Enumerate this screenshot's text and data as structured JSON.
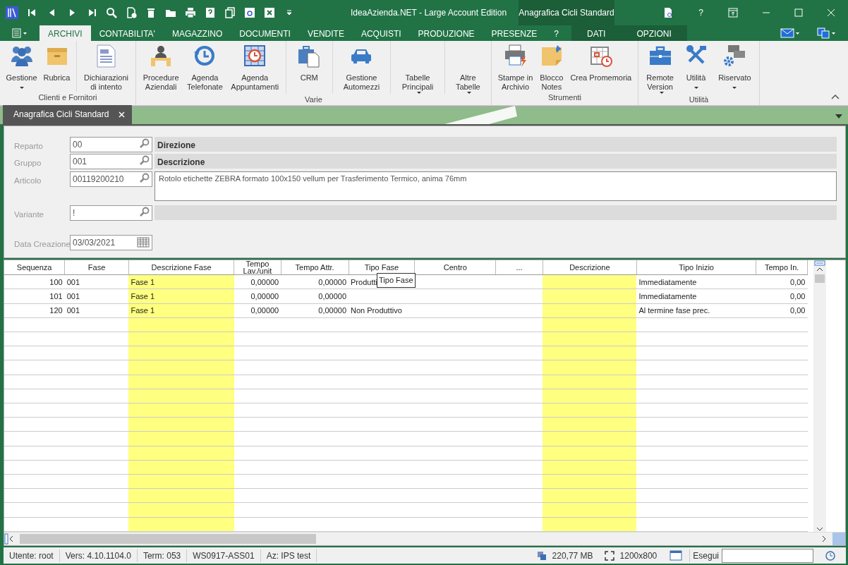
{
  "window": {
    "title": "IdeaAzienda.NET - Large Account Edition",
    "context_title": "Anagrafica Cicli Standard",
    "help_label": "?"
  },
  "ribbon_tabs": [
    {
      "label": "ARCHIVI",
      "selected": true,
      "kind": "standard"
    },
    {
      "label": "CONTABILITA'",
      "selected": false,
      "kind": "standard"
    },
    {
      "label": "MAGAZZINO",
      "selected": false,
      "kind": "standard"
    },
    {
      "label": "DOCUMENTI",
      "selected": false,
      "kind": "standard"
    },
    {
      "label": "VENDITE",
      "selected": false,
      "kind": "standard"
    },
    {
      "label": "ACQUISTI",
      "selected": false,
      "kind": "standard"
    },
    {
      "label": "PRODUZIONE",
      "selected": false,
      "kind": "standard"
    },
    {
      "label": "PRESENZE",
      "selected": false,
      "kind": "standard"
    },
    {
      "label": "?",
      "selected": false,
      "kind": "standard"
    },
    {
      "label": "DATI",
      "selected": false,
      "kind": "contextual"
    },
    {
      "label": "OPZIONI",
      "selected": false,
      "kind": "contextual"
    }
  ],
  "ribbon_groups": [
    {
      "label": "Clienti e Fornitori",
      "sections": [
        [
          {
            "label": "Gestione",
            "dropdown": true
          },
          {
            "label": "Rubrica",
            "dropdown": false
          }
        ],
        [
          {
            "label": "Dichiarazioni\ndi intento",
            "dropdown": false
          }
        ]
      ]
    },
    {
      "label": "Varie",
      "sections": [
        [
          {
            "label": "Procedure\nAziendali",
            "dropdown": false
          },
          {
            "label": "Agenda\nTelefonate",
            "dropdown": false
          },
          {
            "label": "Agenda\nAppuntamenti",
            "dropdown": false
          }
        ],
        [
          {
            "label": "CRM",
            "dropdown": false
          }
        ],
        [
          {
            "label": "Gestione\nAutomezzi",
            "dropdown": false
          }
        ],
        [
          {
            "label": "Tabelle\nPrincipali",
            "dropdown": true
          }
        ],
        [
          {
            "label": "Altre\nTabelle",
            "dropdown": true
          }
        ]
      ]
    },
    {
      "label": "Strumenti",
      "sections": [
        [
          {
            "label": "Stampe in\nArchivio",
            "dropdown": false
          },
          {
            "label": "Blocco\nNotes",
            "dropdown": false
          },
          {
            "label": "Crea Promemoria",
            "dropdown": false
          }
        ]
      ]
    },
    {
      "label": "Utilità",
      "sections": [
        [
          {
            "label": "Remote\nVersion",
            "dropdown": true
          },
          {
            "label": "Utilità",
            "dropdown": true
          },
          {
            "label": "Riservato",
            "dropdown": true
          }
        ]
      ]
    }
  ],
  "document_tabs": [
    {
      "label": "Anagrafica Cicli Standard",
      "selected": true
    }
  ],
  "form": {
    "fields": [
      {
        "label": "Reparto",
        "value": "00",
        "kind": "lookup",
        "description": "Direzione"
      },
      {
        "label": "Gruppo",
        "value": "001",
        "kind": "lookup",
        "description": "Descrizione"
      },
      {
        "label": "Articolo",
        "value": "00119200210",
        "kind": "memo",
        "description": "Rotolo etichette ZEBRA formato 100x150 vellum per Trasferimento Termico, anima 76mm"
      },
      {
        "label": "Variante",
        "value": "!",
        "kind": "lookup"
      },
      {
        "label": "Data Creazione",
        "value": "03/03/2021",
        "kind": "date"
      }
    ]
  },
  "grid": {
    "columns": [
      {
        "label": "Sequenza",
        "numeric": true,
        "highlighted": false
      },
      {
        "label": "Fase",
        "numeric": false,
        "highlighted": false
      },
      {
        "label": "Descrizione Fase",
        "numeric": false,
        "highlighted": true
      },
      {
        "label": "Tempo Lav./unit",
        "numeric": true,
        "highlighted": false
      },
      {
        "label": "Tempo Attr.",
        "numeric": true,
        "highlighted": false
      },
      {
        "label": "Tipo Fase",
        "numeric": false,
        "highlighted": false,
        "tooltip": "Tipo Fase"
      },
      {
        "label": "Centro",
        "highlighted": false
      },
      {
        "label": "...",
        "highlighted": false
      },
      {
        "label": "Descrizione",
        "numeric": false,
        "highlighted": true
      },
      {
        "label": "Tipo Inizio",
        "numeric": false,
        "highlighted": false
      },
      {
        "label": "Tempo In.",
        "numeric": true,
        "highlighted": false
      }
    ],
    "rows": [
      [
        "100",
        "001",
        "Fase 1",
        "0,00000",
        "0,00000",
        "Produtti",
        "",
        "",
        "",
        "Immediatamente",
        "0,00"
      ],
      [
        "101",
        "001",
        "Fase 1",
        "0,00000",
        "0,00000",
        "",
        "",
        "",
        "",
        "Immediatamente",
        "0,00"
      ],
      [
        "120",
        "001",
        "Fase 1",
        "0,00000",
        "0,00000",
        "Non Produttivo",
        "",
        "",
        "",
        "Al termine fase prec.",
        "0,00"
      ]
    ]
  },
  "status_bar": {
    "left": [
      "Utente: root",
      "Vers: 4.10.1104.0",
      "Term: 053",
      "WS0917-ASS01",
      "Az: IPS test"
    ],
    "memory": "220,77 MB",
    "resolution": "1200x800",
    "run_label": "Esegui"
  }
}
